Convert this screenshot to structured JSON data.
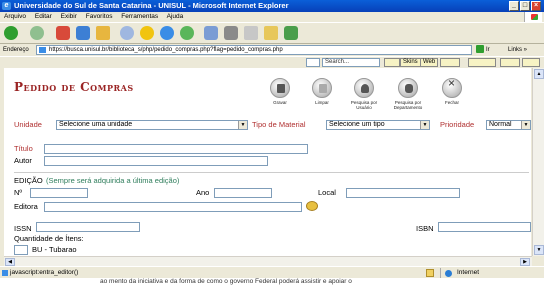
{
  "window": {
    "title": "Universidade do Sul de Santa Catarina - UNISUL - Microsoft Internet Explorer"
  },
  "menu": [
    "Arquivo",
    "Editar",
    "Exibir",
    "Favoritos",
    "Ferramentas",
    "Ajuda"
  ],
  "address": {
    "label": "Endereço",
    "url": "https://busca.unisul.br/biblioteca_s/php/pedido_compras.php?flag=pedido_compras.php",
    "go_label": "Ir",
    "links_label": "Links"
  },
  "google_bar": {
    "search_placeholder": "Search...",
    "buttons": [
      "Skins",
      "Web"
    ]
  },
  "page": {
    "title": "Pedido de Compras",
    "actions": [
      {
        "label": "Gravar",
        "icon": "save-icon"
      },
      {
        "label": "Limpar",
        "icon": "eraser-icon"
      },
      {
        "label": "Pesquisa por Usuário",
        "icon": "user-search-icon"
      },
      {
        "label": "Pesquisa por Departamento",
        "icon": "department-search-icon"
      },
      {
        "label": "Fechar",
        "icon": "close-icon"
      }
    ],
    "unidade_label": "Unidade",
    "unidade_value": "Selecione uma unidade",
    "tipo_label": "Tipo de Material",
    "tipo_value": "Selecione um tipo",
    "prioridade_label": "Prioridade",
    "prioridade_value": "Normal",
    "titulo_label": "Título",
    "autor_label": "Autor",
    "edicao_heading": "EDIÇÃO",
    "edicao_note": "(Sempre será adquirida a última edição)",
    "numero_label": "Nº",
    "ano_label": "Ano",
    "local_label": "Local",
    "editora_label": "Editora",
    "issn_label": "ISSN",
    "isbn_label": "ISBN",
    "quantidade_label": "Quantidade de Ítens:",
    "unit_bu": "BU - Tubarao"
  },
  "status": {
    "text": "javascript:entra_editor()",
    "zone": "Internet"
  },
  "bottom_text": "ao mento da iniciativa e da forma de como o governo Federal poderá assistir e apoiar o"
}
